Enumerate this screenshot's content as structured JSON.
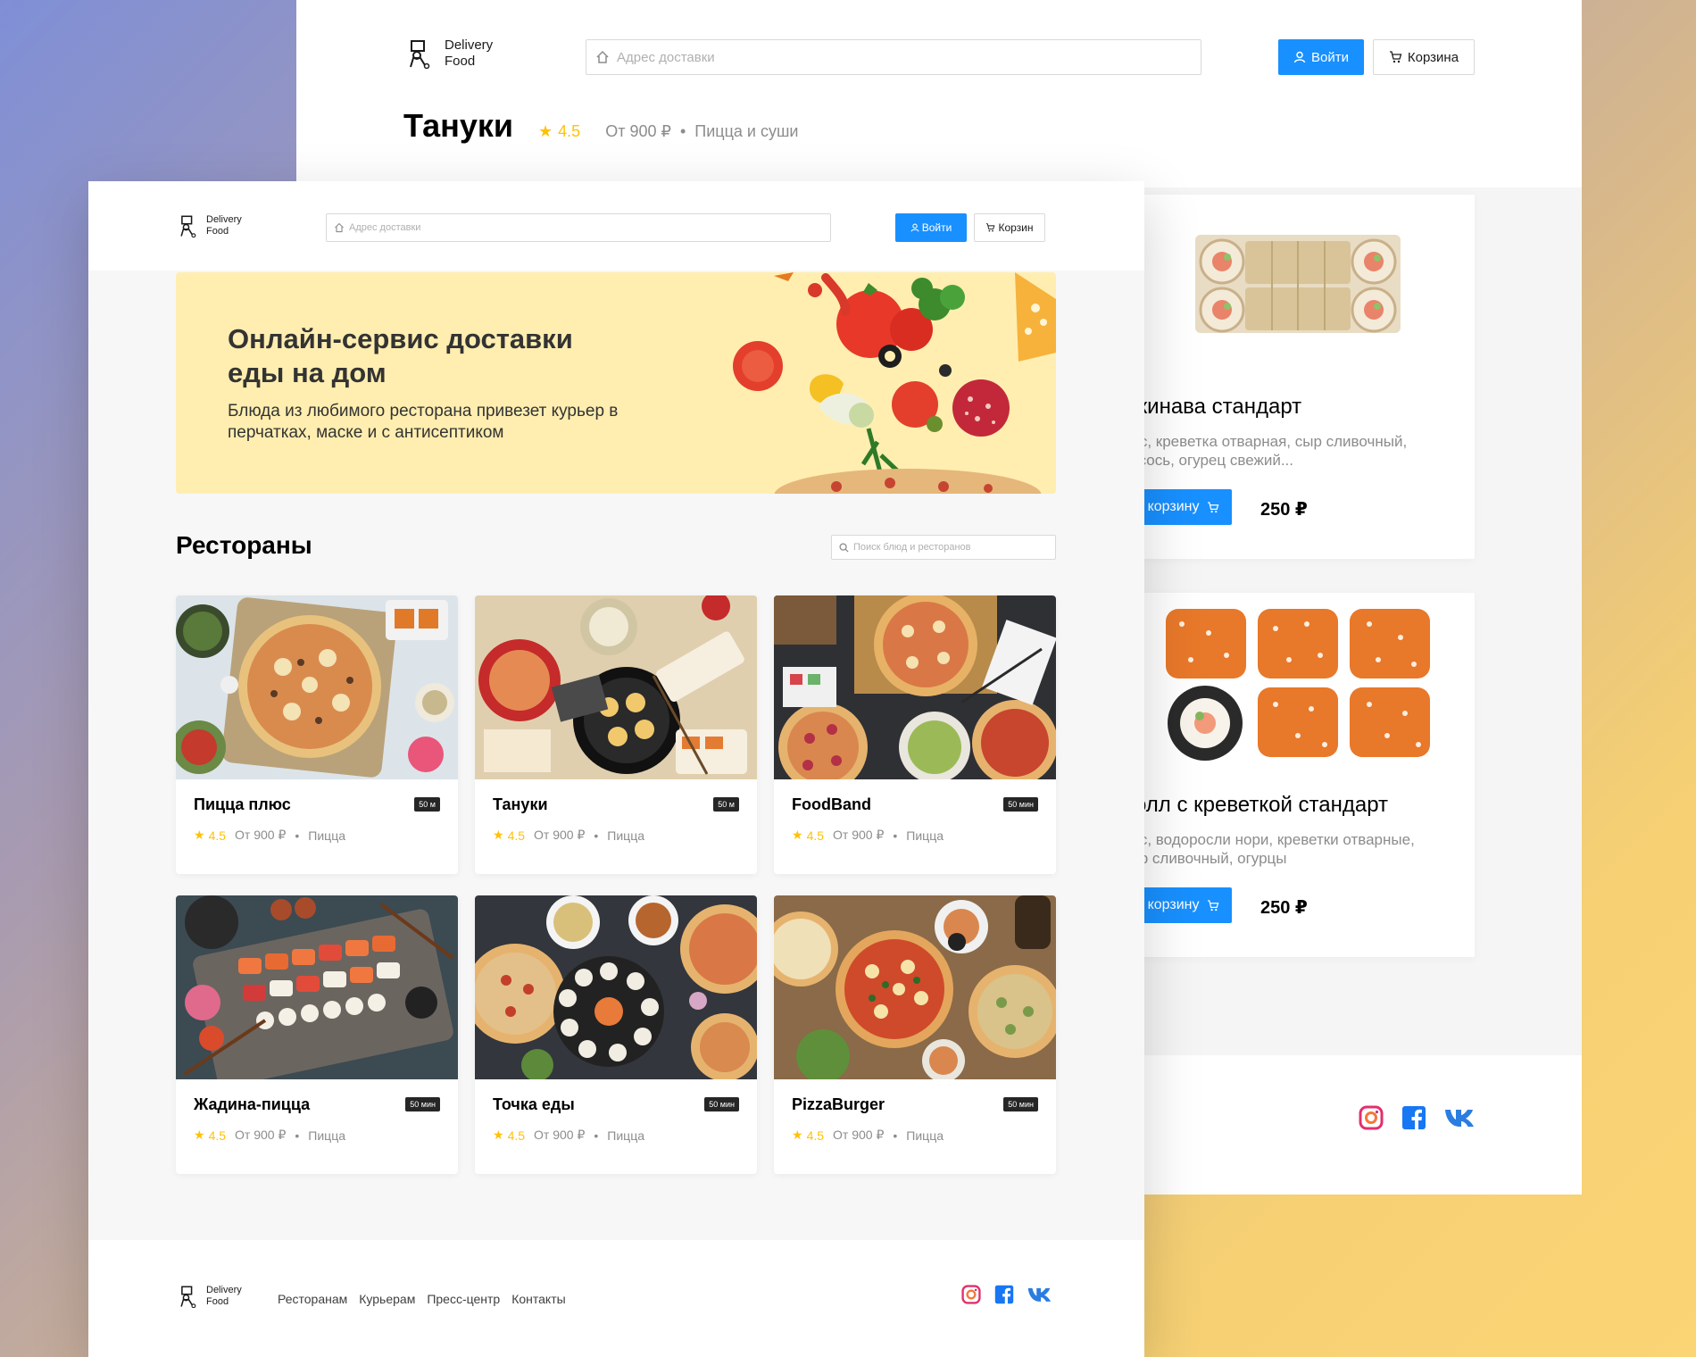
{
  "brand": {
    "line1": "Delivery",
    "line2": "Food"
  },
  "back_page": {
    "search_placeholder": "Адрес доставки",
    "login_label": "Войти",
    "cart_label": "Корзина",
    "restaurant_title": "Тануки",
    "rating": "4.5",
    "price_from": "От 900 ₽",
    "separator": "•",
    "category": "Пицца  и суши",
    "dishes": [
      {
        "name": "Окинава стандарт",
        "description": "Рис, креветка отварная, сыр сливочный, лосось, огурец свежий...",
        "button": "В корзину",
        "price": "250 ₽"
      },
      {
        "name": "Ролл с креветкой стандарт",
        "description": "Рис, водоросли нори, креветки отварные, сыр сливочный, огурцы",
        "button": "В корзину",
        "price": "250 ₽"
      }
    ]
  },
  "front_page": {
    "search_placeholder": "Адрес доставки",
    "login_label": "Войти",
    "cart_label": "Корзин",
    "promo": {
      "title": "Онлайн-сервис доставки еды на дом",
      "text": "Блюда из любимого ресторана привезет курьер в перчатках, маске и с антисептиком"
    },
    "restaurants_title": "Рестораны",
    "restaurants_search_placeholder": "Поиск блюд и ресторанов",
    "restaurants": [
      {
        "name": "Пицца плюс",
        "badge": "50 м",
        "rating": "4.5",
        "price": "От 900 ₽",
        "sep": "•",
        "category": "Пицца"
      },
      {
        "name": "Тануки",
        "badge": "50 м",
        "rating": "4.5",
        "price": "От 900 ₽",
        "sep": "•",
        "category": "Пицца"
      },
      {
        "name": "FoodBand",
        "badge": "50 мин",
        "rating": "4.5",
        "price": "От 900 ₽",
        "sep": "•",
        "category": "Пицца"
      },
      {
        "name": "Жадина-пицца",
        "badge": "50 мин",
        "rating": "4.5",
        "price": "От 900 ₽",
        "sep": "•",
        "category": "Пицца"
      },
      {
        "name": "Точка еды",
        "badge": "50 мин",
        "rating": "4.5",
        "price": "От 900 ₽",
        "sep": "•",
        "category": "Пицца"
      },
      {
        "name": "PizzaBurger",
        "badge": "50 мин",
        "rating": "4.5",
        "price": "От 900 ₽",
        "sep": "•",
        "category": "Пицца"
      }
    ],
    "footer_nav": [
      "Ресторанам",
      "Курьерам",
      "Пресс-центр",
      "Контакты"
    ]
  },
  "colors": {
    "accent": "#1890ff",
    "star": "#ffc107",
    "promo_bg": "#ffeeb0"
  },
  "icons": [
    "logo-icon",
    "home-icon",
    "user-icon",
    "cart-icon",
    "search-icon",
    "star-icon",
    "instagram-icon",
    "facebook-icon",
    "vk-icon"
  ]
}
